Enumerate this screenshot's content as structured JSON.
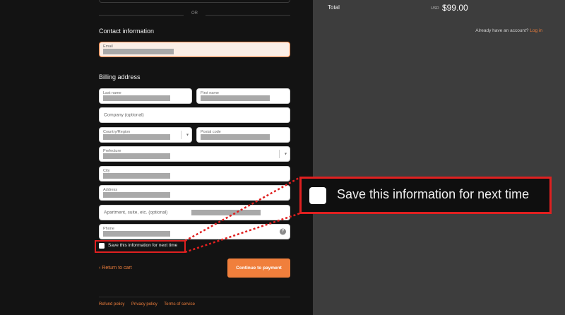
{
  "checkout": {
    "divider_text": "OR",
    "contact_title": "Contact information",
    "login_prompt": "Already have an account?",
    "login_link": "Log in",
    "email_label": "Email",
    "billing_title": "Billing address",
    "last_name_label": "Last name",
    "first_name_label": "First name",
    "company_placeholder": "Company (optional)",
    "country_label": "Country/Region",
    "postal_label": "Postal code",
    "prefecture_label": "Prefecture",
    "city_label": "City",
    "address_label": "Address",
    "apartment_placeholder": "Apartment, suite, etc. (optional)",
    "phone_label": "Phone",
    "save_label": "Save this information for next time",
    "save_checked": false,
    "back_link": "‹ Return to cart",
    "continue_button": "Continue to payment"
  },
  "footer": {
    "refund": "Refund policy",
    "privacy": "Privacy policy",
    "terms": "Terms of service"
  },
  "summary": {
    "total_label": "Total",
    "currency": "USD",
    "amount": "$99.00"
  },
  "zoom_callout": {
    "text": "Save this information for next time"
  },
  "colors": {
    "accent": "#f07f3c",
    "highlight": "#e02020"
  }
}
